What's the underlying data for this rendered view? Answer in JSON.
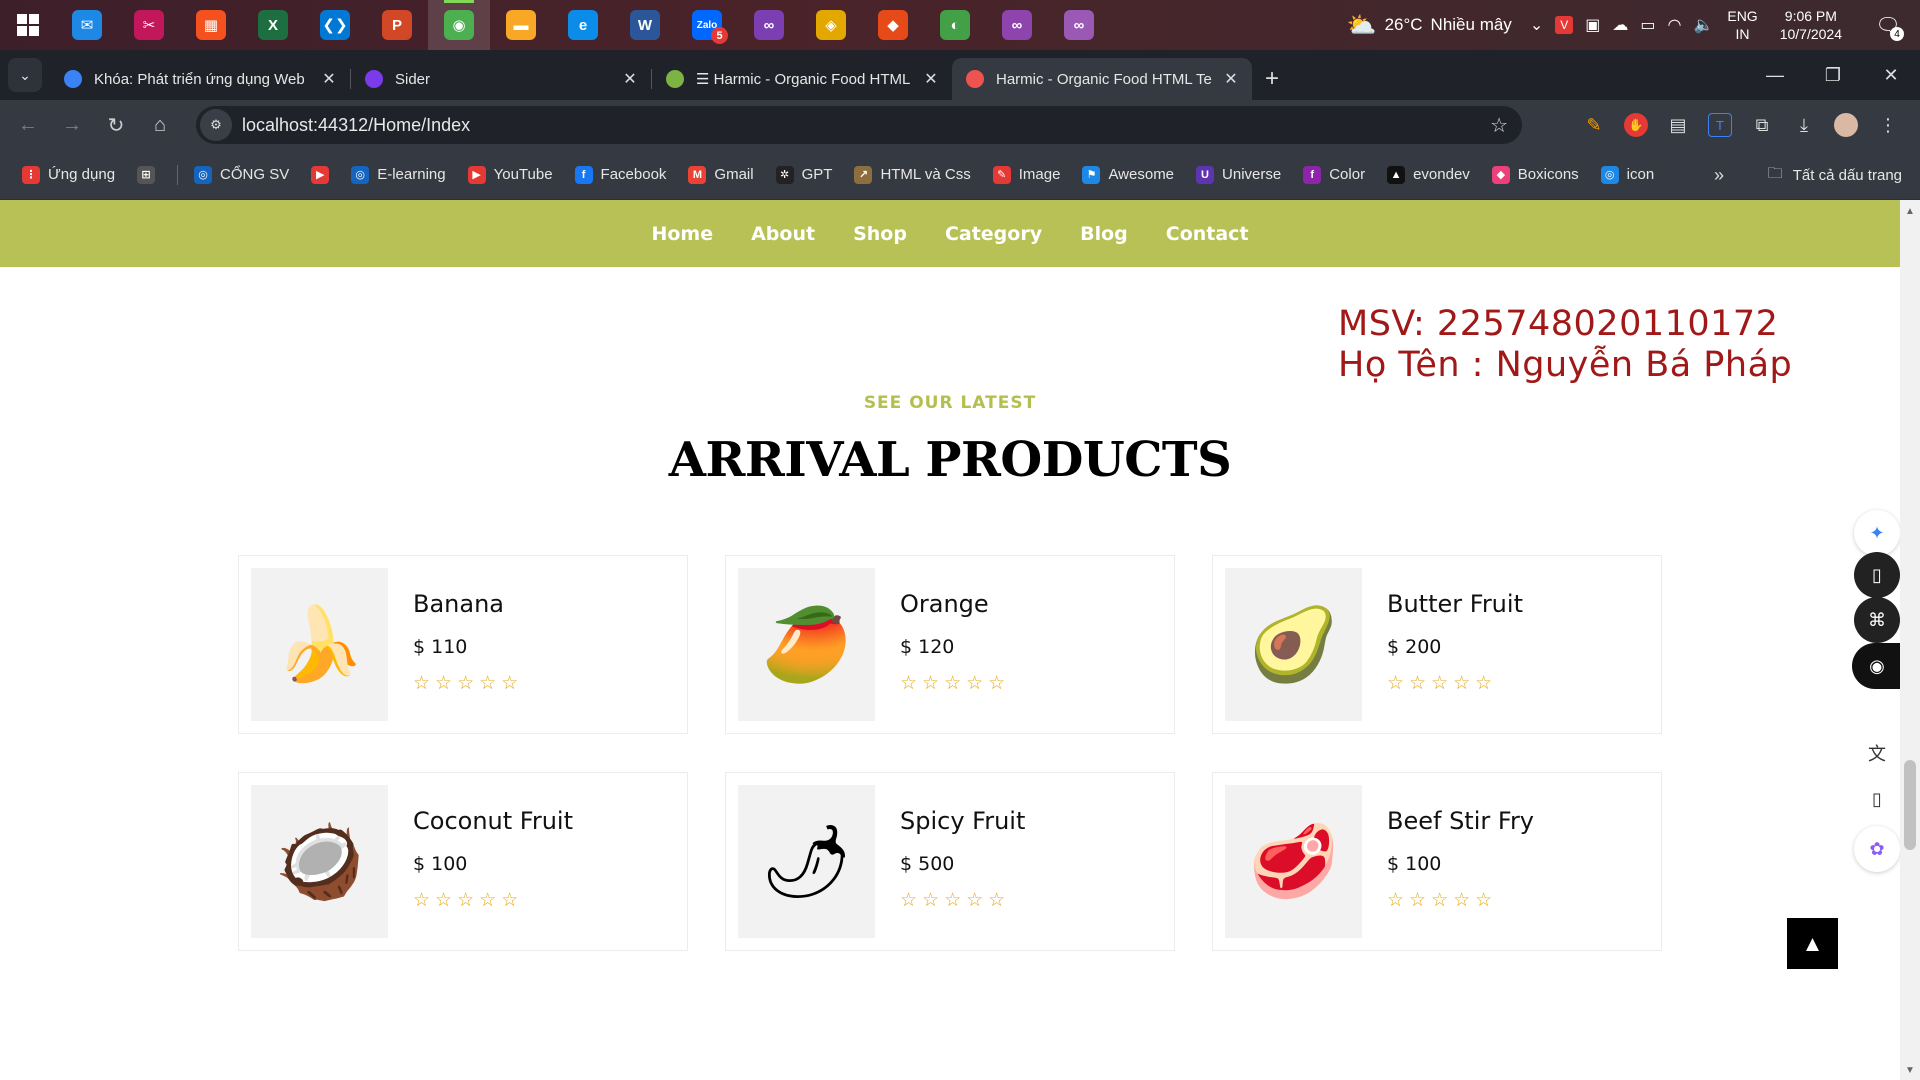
{
  "taskbar": {
    "apps": [
      {
        "name": "mail-app",
        "glyph": "✉",
        "color": "#1e88e5"
      },
      {
        "name": "snipping-app",
        "glyph": "✂",
        "color": "#c2185b"
      },
      {
        "name": "store-app",
        "glyph": "▦",
        "color": "#f4511e"
      },
      {
        "name": "excel-app",
        "glyph": "X",
        "color": "#1d6f42"
      },
      {
        "name": "vscode-app",
        "glyph": "❮❯",
        "color": "#0078d4"
      },
      {
        "name": "powerpoint-app",
        "glyph": "P",
        "color": "#d24726"
      },
      {
        "name": "chrome-app",
        "glyph": "◉",
        "color": "#4caf50"
      },
      {
        "name": "explorer-app",
        "glyph": "▬",
        "color": "#f9a825"
      },
      {
        "name": "edge-app",
        "glyph": "e",
        "color": "#0c8ce9"
      },
      {
        "name": "word-app",
        "glyph": "W",
        "color": "#2b579a"
      },
      {
        "name": "zalo-app",
        "glyph": "Zalo",
        "color": "#0068ff",
        "badge": "5"
      },
      {
        "name": "visual-studio-app",
        "glyph": "∞",
        "color": "#7b3fb2"
      },
      {
        "name": "sourcetree-app",
        "glyph": "◈",
        "color": "#e2a800"
      },
      {
        "name": "git-app",
        "glyph": "◆",
        "color": "#e64a19"
      },
      {
        "name": "greenshot-app",
        "glyph": "◐",
        "color": "#43a047"
      },
      {
        "name": "vs-preview-app",
        "glyph": "∞",
        "color": "#8e44ad"
      },
      {
        "name": "vs-preview-2-app",
        "glyph": "∞",
        "color": "#9b59b6"
      }
    ],
    "weather_temp": "26°C",
    "weather_desc": "Nhiều mây",
    "lang_line1": "ENG",
    "lang_line2": "IN",
    "time": "9:06 PM",
    "date": "10/7/2024",
    "notification_count": "4"
  },
  "browser": {
    "tabs": [
      {
        "title": "Khóa: Phát triển ứng dụng Web",
        "favicon_color": "#3b82f6",
        "active": false
      },
      {
        "title": "Sider",
        "favicon_color": "#7c3aed",
        "active": false
      },
      {
        "title": "☰ Harmic - Organic Food HTML",
        "favicon_color": "#7cb342",
        "active": false
      },
      {
        "title": "Harmic - Organic Food HTML Te",
        "favicon_color": "#ef5350",
        "active": true
      }
    ],
    "url": "localhost:44312/Home/Index",
    "bookmarks": [
      {
        "label": "Ứng dụng",
        "icon_color": "#e53935",
        "glyph": "⋮"
      },
      {
        "label": "",
        "icon_color": "#555",
        "glyph": "⊞"
      },
      {
        "label": "CỔNG SV",
        "icon_color": "#1565c0",
        "glyph": "◎"
      },
      {
        "label": "",
        "icon_color": "#e53935",
        "glyph": "▶"
      },
      {
        "label": "E-learning",
        "icon_color": "#1565c0",
        "glyph": "◎"
      },
      {
        "label": "YouTube",
        "icon_color": "#e53935",
        "glyph": "▶"
      },
      {
        "label": "Facebook",
        "icon_color": "#1877f2",
        "glyph": "f"
      },
      {
        "label": "Gmail",
        "icon_color": "#ea4335",
        "glyph": "M"
      },
      {
        "label": "GPT",
        "icon_color": "#222",
        "glyph": "✲"
      },
      {
        "label": "HTML và Css",
        "icon_color": "#8d6e3f",
        "glyph": "↗"
      },
      {
        "label": "Image",
        "icon_color": "#e53935",
        "glyph": "✎"
      },
      {
        "label": "Awesome",
        "icon_color": "#1e88e5",
        "glyph": "⚑"
      },
      {
        "label": "Universe",
        "icon_color": "#5e35b1",
        "glyph": "U"
      },
      {
        "label": "Color",
        "icon_color": "#8e24aa",
        "glyph": "f"
      },
      {
        "label": "evondev",
        "icon_color": "#111",
        "glyph": "▲"
      },
      {
        "label": "Boxicons",
        "icon_color": "#ec407a",
        "glyph": "◆"
      },
      {
        "label": "icon",
        "icon_color": "#1e88e5",
        "glyph": "◎"
      }
    ],
    "all_bookmarks": "Tất cả dấu trang"
  },
  "site": {
    "nav": [
      "Home",
      "About",
      "Shop",
      "Category",
      "Blog",
      "Contact"
    ],
    "student_id": "MSV: 225748020110172",
    "student_name": "Họ Tên : Nguyễn Bá Pháp",
    "kicker": "SEE OUR LATEST",
    "heading": "ARRIVAL PRODUCTS",
    "products": [
      {
        "name": "Banana",
        "price": "$ 110",
        "rating": 0,
        "icon": "banana-icon",
        "glyph": "🍌"
      },
      {
        "name": "Orange",
        "price": "$ 120",
        "rating": 0,
        "icon": "papaya-icon",
        "glyph": "🥭"
      },
      {
        "name": "Butter Fruit",
        "price": "$ 200",
        "rating": 0,
        "icon": "avocado-icon",
        "glyph": "🥑"
      },
      {
        "name": "Coconut Fruit",
        "price": "$ 100",
        "rating": 0,
        "icon": "coconut-icon",
        "glyph": "🥥"
      },
      {
        "name": "Spicy Fruit",
        "price": "$ 500",
        "rating": 0,
        "icon": "chili-icon",
        "glyph": "🌶"
      },
      {
        "name": "Beef Stir Fry",
        "price": "$ 100",
        "rating": 0,
        "icon": "beef-icon",
        "glyph": "🥩"
      }
    ],
    "stars": "☆☆☆☆☆"
  },
  "colors": {
    "nav_bg": "#b7c155",
    "accent": "#b5bf4e",
    "student_text": "#a01818"
  }
}
